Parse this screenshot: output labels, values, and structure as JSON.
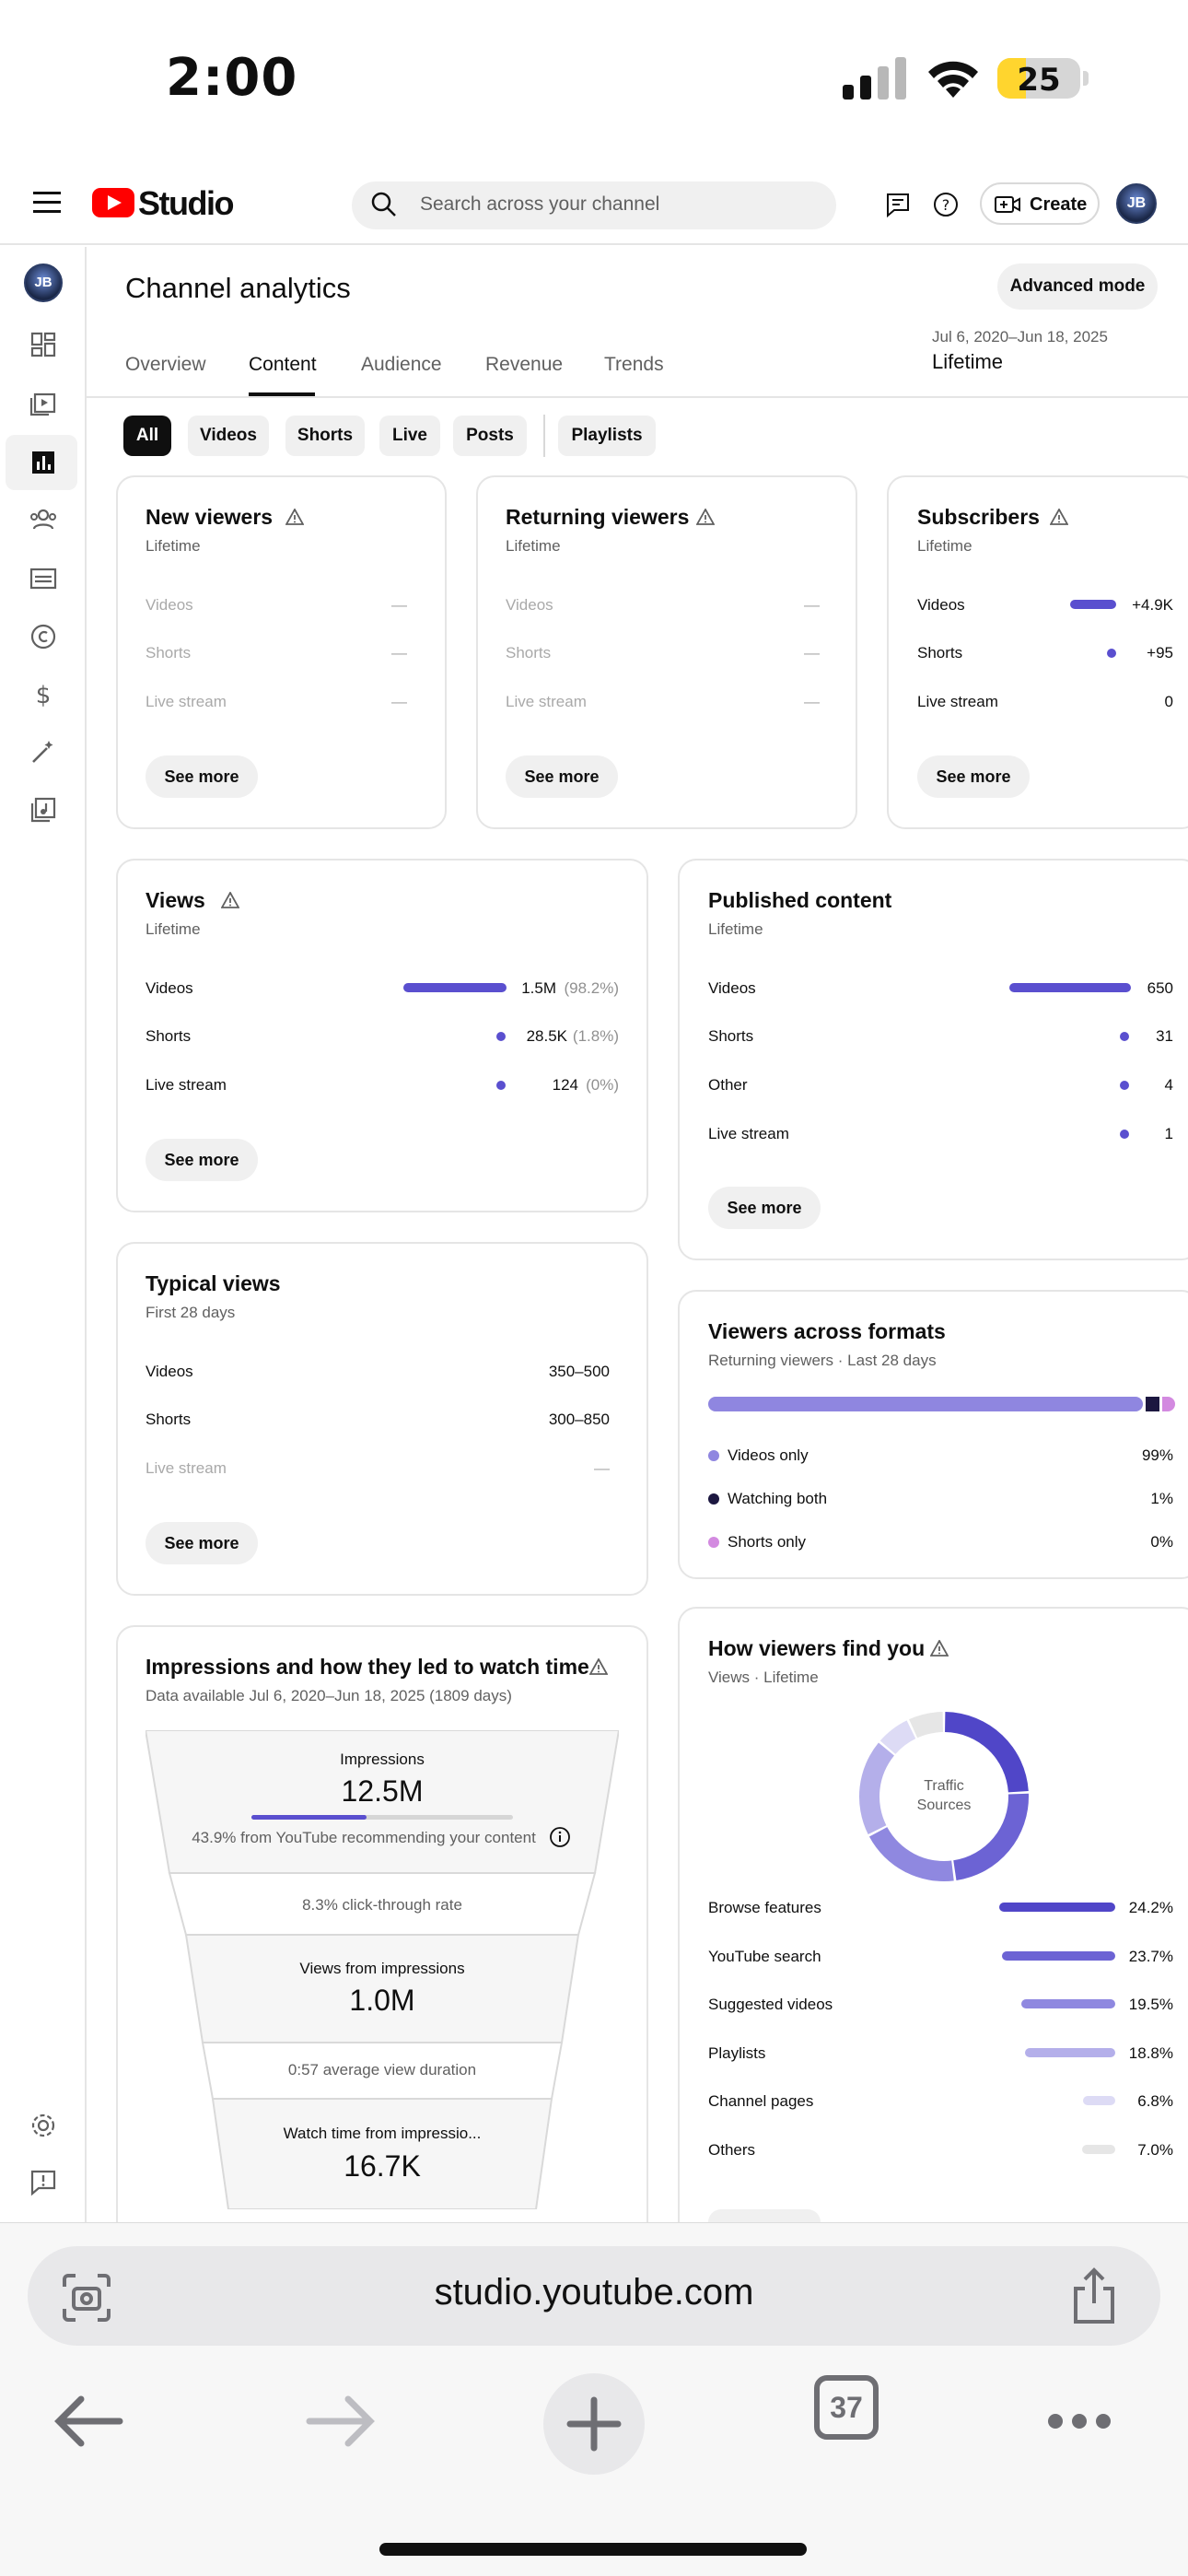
{
  "status_bar": {
    "time": "2:00",
    "battery": "25"
  },
  "header": {
    "logo_text": "Studio",
    "search_placeholder": "Search across your channel",
    "create_label": "Create",
    "avatar_initials": "JB"
  },
  "sidebar": {
    "avatar_initials": "JB"
  },
  "page": {
    "title": "Channel analytics",
    "advanced_mode": "Advanced mode",
    "tabs": [
      "Overview",
      "Content",
      "Audience",
      "Revenue",
      "Trends"
    ],
    "date_range": "Jul 6, 2020–Jun 18, 2025",
    "date_label": "Lifetime",
    "chips": [
      "All",
      "Videos",
      "Shorts",
      "Live",
      "Posts",
      "Playlists"
    ]
  },
  "cards": {
    "new_viewers": {
      "title": "New viewers",
      "subtitle": "Lifetime",
      "rows": [
        {
          "label": "Videos",
          "value": "—"
        },
        {
          "label": "Shorts",
          "value": "—"
        },
        {
          "label": "Live stream",
          "value": "—"
        }
      ],
      "see_more": "See more"
    },
    "returning_viewers": {
      "title": "Returning viewers",
      "subtitle": "Lifetime",
      "rows": [
        {
          "label": "Videos",
          "value": "—"
        },
        {
          "label": "Shorts",
          "value": "—"
        },
        {
          "label": "Live stream",
          "value": "—"
        }
      ],
      "see_more": "See more"
    },
    "subscribers": {
      "title": "Subscribers",
      "subtitle": "Lifetime",
      "rows": [
        {
          "label": "Videos",
          "value": "+4.9K"
        },
        {
          "label": "Shorts",
          "value": "+95"
        },
        {
          "label": "Live stream",
          "value": "0"
        }
      ],
      "see_more": "See more"
    },
    "views": {
      "title": "Views",
      "subtitle": "Lifetime",
      "rows": [
        {
          "label": "Videos",
          "value": "1.5M",
          "pct": "(98.2%)",
          "share": 0.982
        },
        {
          "label": "Shorts",
          "value": "28.5K",
          "pct": "(1.8%)",
          "share": 0.018
        },
        {
          "label": "Live stream",
          "value": "124",
          "pct": "(0%)",
          "share": 0
        }
      ],
      "see_more": "See more"
    },
    "published": {
      "title": "Published content",
      "subtitle": "Lifetime",
      "rows": [
        {
          "label": "Videos",
          "value": "650"
        },
        {
          "label": "Shorts",
          "value": "31"
        },
        {
          "label": "Other",
          "value": "4"
        },
        {
          "label": "Live stream",
          "value": "1"
        }
      ],
      "see_more": "See more"
    },
    "typical_views": {
      "title": "Typical views",
      "subtitle": "First 28 days",
      "rows": [
        {
          "label": "Videos",
          "value": "350–500"
        },
        {
          "label": "Shorts",
          "value": "300–850"
        },
        {
          "label": "Live stream",
          "value": "—"
        }
      ],
      "see_more": "See more"
    },
    "viewers_formats": {
      "title": "Viewers across formats",
      "subtitle": "Returning viewers · Last 28 days",
      "rows": [
        {
          "label": "Videos only",
          "value": "99%",
          "color": "#8f86e0"
        },
        {
          "label": "Watching both",
          "value": "1%",
          "color": "#1c1740"
        },
        {
          "label": "Shorts only",
          "value": "0%",
          "color": "#d38ae0"
        }
      ]
    },
    "impressions": {
      "title": "Impressions and how they led to watch time",
      "subtitle": "Data available Jul 6, 2020–Jun 18, 2025 (1809 days)",
      "impressions_label": "Impressions",
      "impressions_value": "12.5M",
      "impressions_progress": 0.439,
      "recommend_text": "43.9% from YouTube recommending your content",
      "ctr_text": "8.3% click-through rate",
      "views_label": "Views from impressions",
      "views_value": "1.0M",
      "avd_text": "0:57 average view duration",
      "watch_label": "Watch time from impressio...",
      "watch_value": "16.7K"
    },
    "traffic": {
      "title": "How viewers find you",
      "subtitle": "Views · Lifetime",
      "donut_label_1": "Traffic",
      "donut_label_2": "Sources",
      "rows": [
        {
          "label": "Browse features",
          "value": "24.2%",
          "color": "#5046c8"
        },
        {
          "label": "YouTube search",
          "value": "23.7%",
          "color": "#6c63d4"
        },
        {
          "label": "Suggested videos",
          "value": "19.5%",
          "color": "#8f88e0"
        },
        {
          "label": "Playlists",
          "value": "18.8%",
          "color": "#b4afea"
        },
        {
          "label": "Channel pages",
          "value": "6.8%",
          "color": "#dddbf5"
        },
        {
          "label": "Others",
          "value": "7.0%",
          "color": "#e6e6e6"
        }
      ]
    }
  },
  "browser": {
    "url": "studio.youtube.com",
    "tab_count": "37"
  }
}
